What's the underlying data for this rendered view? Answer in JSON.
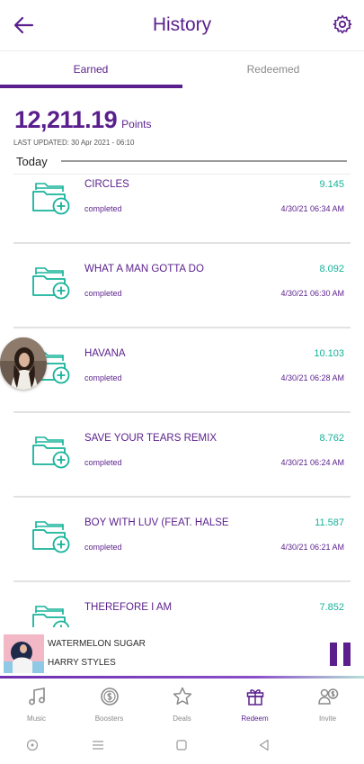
{
  "header": {
    "title": "History"
  },
  "tabs": [
    {
      "label": "Earned",
      "active": true
    },
    {
      "label": "Redeemed",
      "active": false
    }
  ],
  "summary": {
    "points_value": "12,211.19",
    "points_unit": "Points",
    "last_updated": "LAST UPDATED: 30 Apr 2021 - 06:10"
  },
  "section": {
    "label": "Today"
  },
  "items": [
    {
      "song": "CIRCLES",
      "points": "9.145",
      "status": "completed",
      "time": "4/30/21 06:34 AM"
    },
    {
      "song": "WHAT A MAN GOTTA DO",
      "points": "8.092",
      "status": "completed",
      "time": "4/30/21 06:30 AM"
    },
    {
      "song": "HAVANA",
      "points": "10.103",
      "status": "completed",
      "time": "4/30/21 06:28 AM"
    },
    {
      "song": "SAVE YOUR TEARS REMIX",
      "points": "8.762",
      "status": "completed",
      "time": "4/30/21 06:24 AM"
    },
    {
      "song": "BOY WITH LUV (FEAT. HALSE",
      "points": "11.587",
      "status": "completed",
      "time": "4/30/21 06:21 AM"
    },
    {
      "song": "THEREFORE I AM",
      "points": "7.852"
    }
  ],
  "player": {
    "title": "WATERMELON SUGAR",
    "artist": "HARRY STYLES"
  },
  "bottom_nav": [
    {
      "label": "Music",
      "icon": "music-note-icon",
      "active": false
    },
    {
      "label": "Boosters",
      "icon": "coin-icon",
      "active": false
    },
    {
      "label": "Deals",
      "icon": "star-icon",
      "active": false
    },
    {
      "label": "Redeem",
      "icon": "gift-icon",
      "active": true
    },
    {
      "label": "Invite",
      "icon": "invite-icon",
      "active": false
    }
  ],
  "colors": {
    "brand": "#5a1f8c",
    "accent": "#16b39a"
  }
}
